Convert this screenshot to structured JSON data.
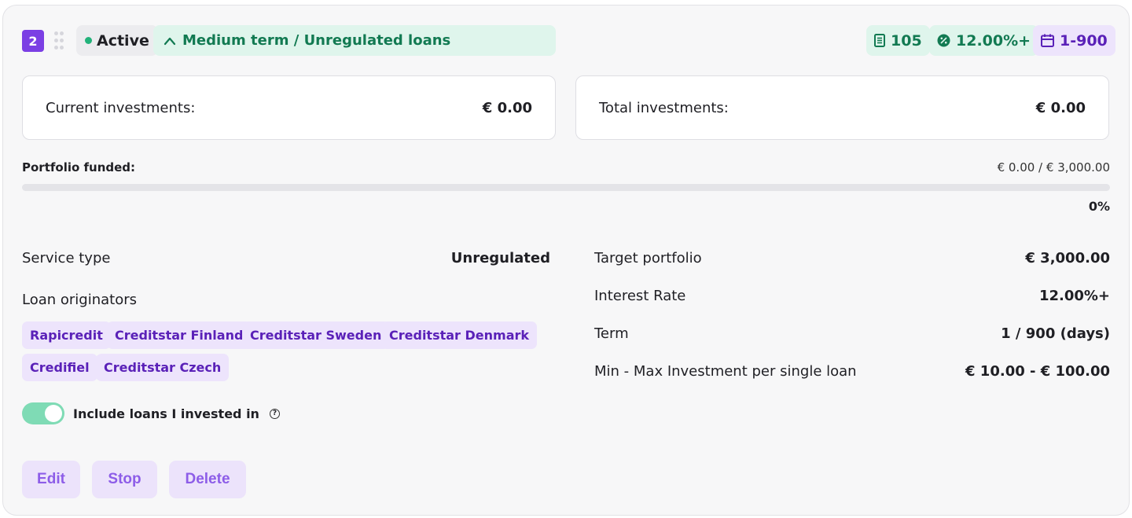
{
  "header": {
    "number": "2",
    "status": "Active",
    "term": "Medium term / Unregulated loans",
    "stats": {
      "loans_count": "105",
      "interest": "12.00%+",
      "days_range": "1-900"
    }
  },
  "investments": {
    "current_label": "Current investments:",
    "current_value": "€ 0.00",
    "total_label": "Total investments:",
    "total_value": "€ 0.00"
  },
  "portfolio": {
    "label": "Portfolio funded:",
    "amount": "€ 0.00 / € 3,000.00",
    "percent_text": "0%",
    "progress_fraction": 0
  },
  "details_left": {
    "service_type_label": "Service type",
    "service_type_value": "Unregulated",
    "loan_originators_label": "Loan originators",
    "originators": [
      "Rapicredit",
      "Creditstar Finland",
      "Creditstar Sweden",
      "Creditstar Denmark",
      "Credifiel",
      "Creditstar Czech"
    ]
  },
  "details_right": {
    "target_label": "Target portfolio",
    "target_value": "€ 3,000.00",
    "rate_label": "Interest Rate",
    "rate_value": "12.00%+",
    "term_label": "Term",
    "term_value": "1 / 900 (days)",
    "minmax_label": "Min - Max Investment per single loan",
    "minmax_value": "€ 10.00 - € 100.00"
  },
  "toggle": {
    "label": "Include loans I invested in",
    "on": true,
    "help": "?"
  },
  "actions": {
    "edit": "Edit",
    "stop": "Stop",
    "delete": "Delete"
  },
  "colors": {
    "brand_purple": "#7b3fe4",
    "green_text": "#127a52",
    "green_bg": "#dff5ec",
    "purple_bg": "#ede4fc"
  }
}
